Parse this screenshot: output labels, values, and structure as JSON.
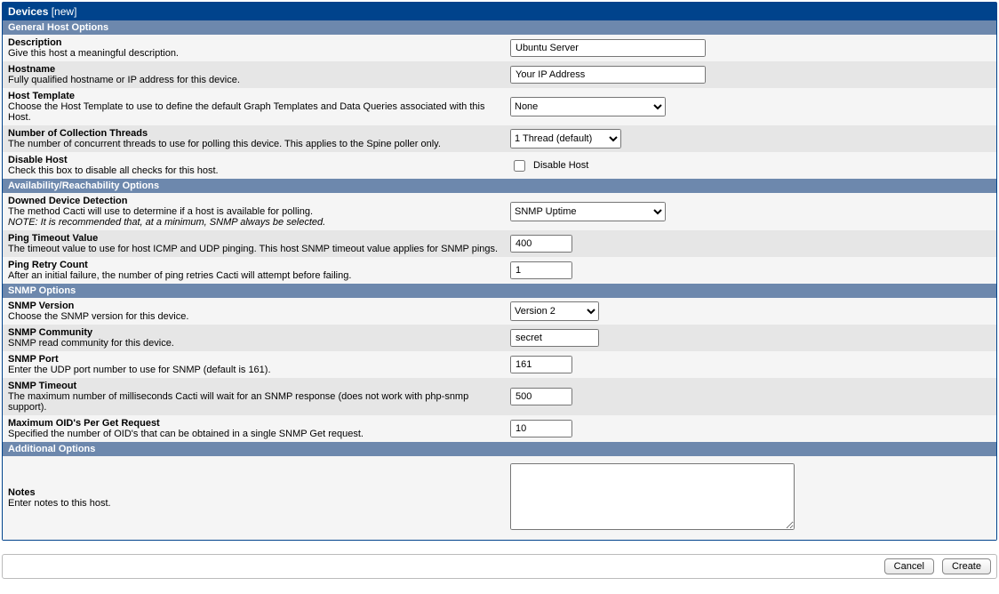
{
  "header": {
    "title": "Devices",
    "sub": "[new]"
  },
  "sections": {
    "general": {
      "title": "General Host Options",
      "description": {
        "label": "Description",
        "help": "Give this host a meaningful description.",
        "value": "Ubuntu Server"
      },
      "hostname": {
        "label": "Hostname",
        "help": "Fully qualified hostname or IP address for this device.",
        "value": "Your IP Address"
      },
      "template": {
        "label": "Host Template",
        "help": "Choose the Host Template to use to define the default Graph Templates and Data Queries associated with this Host.",
        "value": "None"
      },
      "threads": {
        "label": "Number of Collection Threads",
        "help": "The number of concurrent threads to use for polling this device. This applies to the Spine poller only.",
        "value": "1 Thread (default)"
      },
      "disable": {
        "label": "Disable Host",
        "help": "Check this box to disable all checks for this host.",
        "check_label": "Disable Host",
        "checked": false
      }
    },
    "availability": {
      "title": "Availability/Reachability Options",
      "detection": {
        "label": "Downed Device Detection",
        "help": "The method Cacti will use to determine if a host is available for polling.",
        "note": "NOTE: It is recommended that, at a minimum, SNMP always be selected.",
        "value": "SNMP Uptime"
      },
      "ping_timeout": {
        "label": "Ping Timeout Value",
        "help": "The timeout value to use for host ICMP and UDP pinging. This host SNMP timeout value applies for SNMP pings.",
        "value": "400"
      },
      "ping_retry": {
        "label": "Ping Retry Count",
        "help": "After an initial failure, the number of ping retries Cacti will attempt before failing.",
        "value": "1"
      }
    },
    "snmp": {
      "title": "SNMP Options",
      "version": {
        "label": "SNMP Version",
        "help": "Choose the SNMP version for this device.",
        "value": "Version 2"
      },
      "community": {
        "label": "SNMP Community",
        "help": "SNMP read community for this device.",
        "value": "secret"
      },
      "port": {
        "label": "SNMP Port",
        "help": "Enter the UDP port number to use for SNMP (default is 161).",
        "value": "161"
      },
      "timeout": {
        "label": "SNMP Timeout",
        "help": "The maximum number of milliseconds Cacti will wait for an SNMP response (does not work with php-snmp support).",
        "value": "500"
      },
      "max_oids": {
        "label": "Maximum OID's Per Get Request",
        "help": "Specified the number of OID's that can be obtained in a single SNMP Get request.",
        "value": "10"
      }
    },
    "additional": {
      "title": "Additional Options",
      "notes": {
        "label": "Notes",
        "help": "Enter notes to this host.",
        "value": ""
      }
    }
  },
  "buttons": {
    "cancel": "Cancel",
    "create": "Create"
  }
}
